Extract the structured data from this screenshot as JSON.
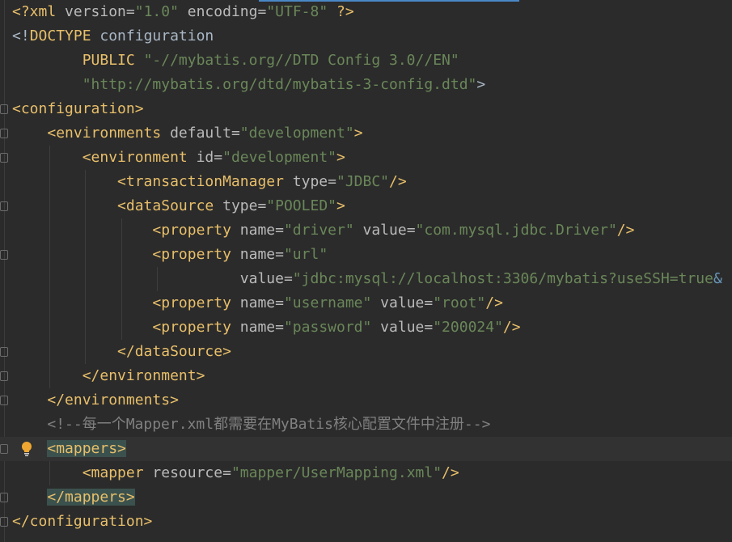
{
  "editor": {
    "language": "xml",
    "current_line": 18,
    "lines": [
      [
        [
          "t",
          "<?xml "
        ],
        [
          "a",
          "version"
        ],
        [
          "a",
          "="
        ],
        [
          "s",
          "\"1.0\""
        ],
        [
          "a",
          " encoding"
        ],
        [
          "a",
          "="
        ],
        [
          "s",
          "\"UTF-8\""
        ],
        [
          "t",
          " ?>"
        ]
      ],
      [
        [
          "p",
          "<!"
        ],
        [
          "d",
          "DOCTYPE"
        ],
        [
          "p",
          " configuration"
        ]
      ],
      [
        [
          "p",
          "        "
        ],
        [
          "d",
          "PUBLIC"
        ],
        [
          "s",
          " \"-//mybatis.org//DTD Config 3.0//EN\""
        ]
      ],
      [
        [
          "p",
          "        "
        ],
        [
          "s",
          "\"http://mybatis.org/dtd/mybatis-3-config.dtd\""
        ],
        [
          "p",
          ">"
        ]
      ],
      [
        [
          "t",
          "<configuration>"
        ]
      ],
      [
        [
          "p",
          "    "
        ],
        [
          "t",
          "<environments"
        ],
        [
          "a",
          " default"
        ],
        [
          "a",
          "="
        ],
        [
          "s",
          "\"development\""
        ],
        [
          "t",
          ">"
        ]
      ],
      [
        [
          "p",
          "        "
        ],
        [
          "t",
          "<environment"
        ],
        [
          "a",
          " id"
        ],
        [
          "a",
          "="
        ],
        [
          "s",
          "\"development\""
        ],
        [
          "t",
          ">"
        ]
      ],
      [
        [
          "p",
          "            "
        ],
        [
          "t",
          "<transactionManager"
        ],
        [
          "a",
          " type"
        ],
        [
          "a",
          "="
        ],
        [
          "s",
          "\"JDBC\""
        ],
        [
          "t",
          "/>"
        ]
      ],
      [
        [
          "p",
          "            "
        ],
        [
          "t",
          "<dataSource"
        ],
        [
          "a",
          " type"
        ],
        [
          "a",
          "="
        ],
        [
          "s",
          "\"POOLED\""
        ],
        [
          "t",
          ">"
        ]
      ],
      [
        [
          "p",
          "                "
        ],
        [
          "t",
          "<property"
        ],
        [
          "a",
          " name"
        ],
        [
          "a",
          "="
        ],
        [
          "s",
          "\"driver\""
        ],
        [
          "a",
          " value"
        ],
        [
          "a",
          "="
        ],
        [
          "s",
          "\"com.mysql.jdbc.Driver\""
        ],
        [
          "t",
          "/>"
        ]
      ],
      [
        [
          "p",
          "                "
        ],
        [
          "t",
          "<property"
        ],
        [
          "a",
          " name"
        ],
        [
          "a",
          "="
        ],
        [
          "s",
          "\"url\""
        ]
      ],
      [
        [
          "p",
          "                          "
        ],
        [
          "a",
          "value"
        ],
        [
          "a",
          "="
        ],
        [
          "s",
          "\"jdbc:mysql://localhost:3306/mybatis?useSSH=true"
        ],
        [
          "e",
          "&"
        ]
      ],
      [
        [
          "p",
          "                "
        ],
        [
          "t",
          "<property"
        ],
        [
          "a",
          " name"
        ],
        [
          "a",
          "="
        ],
        [
          "s",
          "\"username\""
        ],
        [
          "a",
          " value"
        ],
        [
          "a",
          "="
        ],
        [
          "s",
          "\"root\""
        ],
        [
          "t",
          "/>"
        ]
      ],
      [
        [
          "p",
          "                "
        ],
        [
          "t",
          "<property"
        ],
        [
          "a",
          " name"
        ],
        [
          "a",
          "="
        ],
        [
          "s",
          "\"password\""
        ],
        [
          "a",
          " value"
        ],
        [
          "a",
          "="
        ],
        [
          "s",
          "\"200024\""
        ],
        [
          "t",
          "/>"
        ]
      ],
      [
        [
          "p",
          "            "
        ],
        [
          "t",
          "</dataSource>"
        ]
      ],
      [
        [
          "p",
          "        "
        ],
        [
          "t",
          "</environment>"
        ]
      ],
      [
        [
          "p",
          "    "
        ],
        [
          "t",
          "</environments>"
        ]
      ],
      [
        [
          "p",
          "    "
        ],
        [
          "c",
          "<!--每一个Mapper.xml都需要在MyBatis核心配置文件中注册-->"
        ]
      ],
      [
        [
          "p",
          "    "
        ],
        [
          "tm",
          "<mappers>"
        ]
      ],
      [
        [
          "p",
          "        "
        ],
        [
          "t",
          "<mapper"
        ],
        [
          "a",
          " resource"
        ],
        [
          "a",
          "="
        ],
        [
          "s",
          "\"mapper/UserMapping.xml\""
        ],
        [
          "t",
          "/>"
        ]
      ],
      [
        [
          "p",
          "    "
        ],
        [
          "tm",
          "</mappers>"
        ]
      ],
      [
        [
          "t",
          "</configuration>"
        ]
      ]
    ]
  }
}
